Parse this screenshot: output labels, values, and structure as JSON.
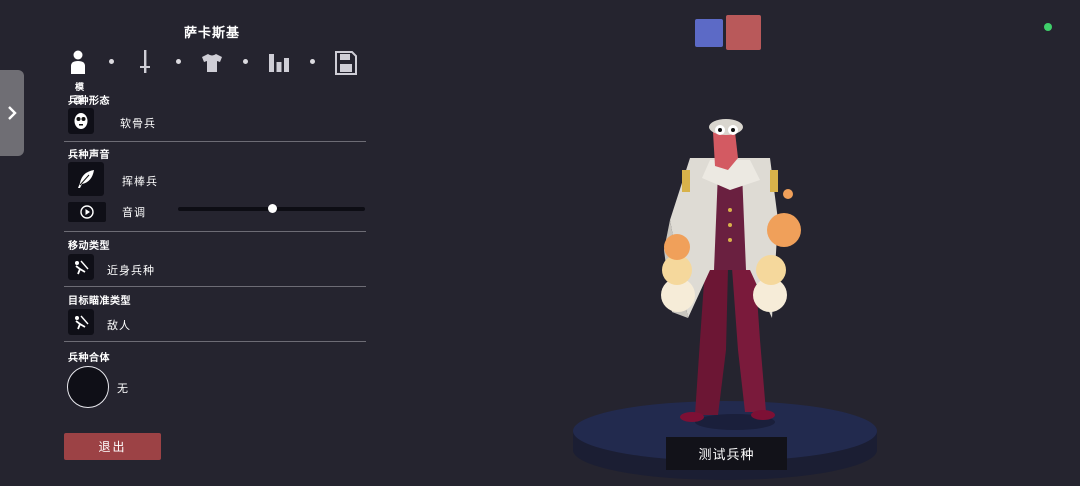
{
  "unit_name": "萨卡斯基",
  "tabs": [
    {
      "label": "模型",
      "icon": "person-icon",
      "active": true
    },
    {
      "label": "",
      "icon": "sword-icon",
      "active": false
    },
    {
      "label": "",
      "icon": "shirt-icon",
      "active": false
    },
    {
      "label": "",
      "icon": "stats-icon",
      "active": false
    },
    {
      "label": "",
      "icon": "save-icon",
      "active": false
    }
  ],
  "sections": {
    "unit_form": {
      "label": "兵种形态",
      "value": "软骨兵",
      "icon": "skull-mask-icon"
    },
    "unit_voice": {
      "label": "兵种声音",
      "value": "挥棒兵",
      "icon": "feather-icon",
      "pitch_label": "音调",
      "pitch_value": 0.5
    },
    "movement_type": {
      "label": "移动类型",
      "value": "近身兵种",
      "icon": "melee-unit-icon"
    },
    "target_type": {
      "label": "目标瞄准类型",
      "value": "敌人",
      "icon": "target-unit-icon"
    },
    "unit_fusion": {
      "label": "兵种合体",
      "value": "无"
    }
  },
  "exit_label": "退出",
  "test_label": "测试兵种",
  "team_colors": {
    "blue": "#5c6ac6",
    "red": "#b9595a"
  },
  "status_color": "#3fcf6a"
}
